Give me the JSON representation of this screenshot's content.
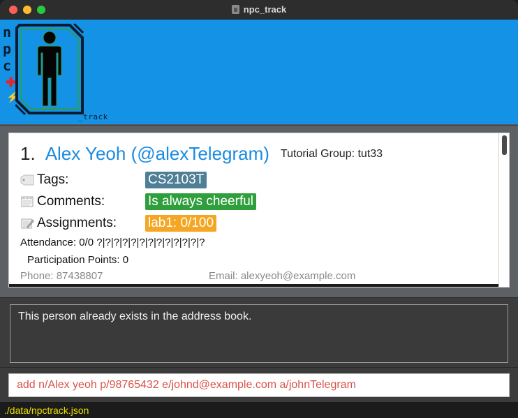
{
  "window": {
    "title": "npc_track"
  },
  "logo": {
    "letters": [
      "n",
      "p",
      "c"
    ],
    "suffix": "_track"
  },
  "person": {
    "index": "1.",
    "name": "Alex Yeoh (@alexTelegram)",
    "tutorial_group": "Tutorial Group: tut33",
    "tags_label": "Tags:",
    "tags": [
      "CS2103T"
    ],
    "comments_label": "Comments:",
    "comments": [
      "Is always cheerful"
    ],
    "assignments_label": "Assignments:",
    "assignments": [
      "lab1: 0/100"
    ],
    "attendance": "Attendance: 0/0  ?|?|?|?|?|?|?|?|?|?|?|?|?",
    "participation": "Participation Points: 0",
    "phone": "Phone: 87438807",
    "email": "Email: alexyeoh@example.com"
  },
  "result": {
    "message": "This person already exists in the address book."
  },
  "command": {
    "value": "add n/Alex yeoh p/98765432 e/johnd@example.com a/johnTelegram"
  },
  "status": {
    "path": "./data/npctrack.json"
  },
  "colors": {
    "header": "#1492e6",
    "name": "#1b8be0",
    "tag": "#4f7f96",
    "comment": "#2e9f3c",
    "assignment": "#f5a623",
    "command_text": "#d9534a",
    "status_text": "#e9e000"
  }
}
